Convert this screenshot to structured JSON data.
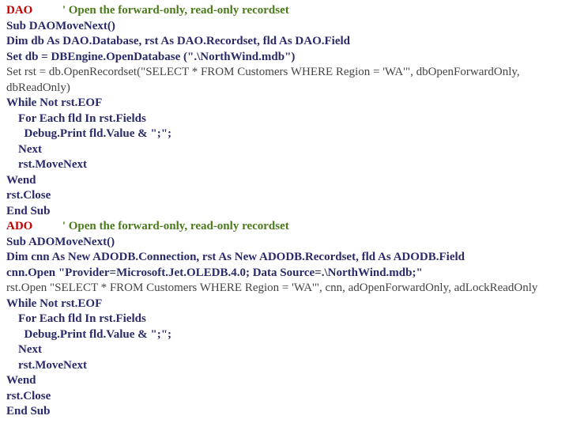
{
  "dao": {
    "tag": "DAO",
    "comment": "' Open the forward-only, read-only recordset",
    "lines": [
      {
        "text": "Sub DAOMoveNext()",
        "style": "bold"
      },
      {
        "text": "Dim db As DAO.Database, rst As DAO.Recordset, fld As DAO.Field",
        "style": "bold"
      },
      {
        "text": "Set db = DBEngine.OpenDatabase (\".\\NorthWind.mdb\")",
        "style": "bold"
      },
      {
        "text": "Set rst = db.OpenRecordset(\"SELECT * FROM Customers WHERE Region = 'WA'\",  dbOpenForwardOnly, dbReadOnly)",
        "style": "plain",
        "wrap": true
      },
      {
        "text": "While Not rst.EOF",
        "style": "bold"
      },
      {
        "text": "    For Each fld In rst.Fields",
        "style": "bold"
      },
      {
        "text": "      Debug.Print fld.Value & \";\";",
        "style": "bold"
      },
      {
        "text": "    Next",
        "style": "bold"
      },
      {
        "text": "    rst.MoveNext",
        "style": "bold"
      },
      {
        "text": "Wend",
        "style": "bold"
      },
      {
        "text": "rst.Close",
        "style": "bold"
      },
      {
        "text": "End Sub",
        "style": "bold"
      }
    ]
  },
  "ado": {
    "tag": "ADO",
    "comment": "' Open the forward-only, read-only recordset",
    "lines": [
      {
        "text": "Sub ADOMoveNext()",
        "style": "bold"
      },
      {
        "text": "Dim cnn As New ADODB.Connection, rst As New ADODB.Recordset, fld As ADODB.Field",
        "style": "bold"
      },
      {
        "text": "cnn.Open \"Provider=Microsoft.Jet.OLEDB.4.0; Data Source=.\\NorthWind.mdb;\"",
        "style": "bold"
      },
      {
        "text": "rst.Open \"SELECT * FROM Customers WHERE Region = 'WA'\", cnn, adOpenForwardOnly, adLockReadOnly",
        "style": "plain",
        "wrap": true
      },
      {
        "text": "While Not rst.EOF",
        "style": "bold"
      },
      {
        "text": "    For Each fld In rst.Fields",
        "style": "bold"
      },
      {
        "text": "      Debug.Print fld.Value & \";\";",
        "style": "bold"
      },
      {
        "text": "    Next",
        "style": "bold"
      },
      {
        "text": "    rst.MoveNext",
        "style": "bold"
      },
      {
        "text": "Wend",
        "style": "bold"
      },
      {
        "text": "rst.Close",
        "style": "bold"
      },
      {
        "text": "End Sub",
        "style": "bold"
      }
    ]
  }
}
